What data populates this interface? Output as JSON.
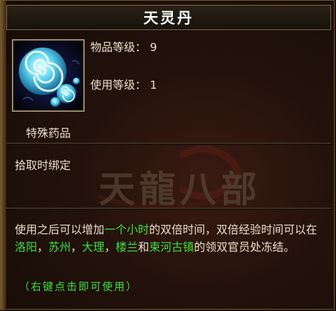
{
  "item": {
    "name": "天灵丹",
    "icon": "swirl-orb-icon",
    "item_level_label": "物品等级：",
    "item_level_value": "9",
    "use_level_label": "使用等级：",
    "use_level_value": "1",
    "category": "特殊药品",
    "binding": "拾取时绑定",
    "watermark_text": "天龍八部",
    "description": {
      "p1": "使用之后可以增加",
      "hl1": "一个小时",
      "p2": "的双倍时间，双倍经验时间可以在",
      "hl2": "洛阳",
      "sep1": "，",
      "hl3": "苏州",
      "sep2": "，",
      "hl4": "大理",
      "sep3": "，",
      "hl5": "楼兰",
      "p3": "和",
      "hl6": "束河古镇",
      "p4": "的领双官员处冻结。"
    },
    "usage_hint": "（右键点击即可使用）"
  },
  "colors": {
    "text": "#ecdfc8",
    "highlight": "#3ee03e",
    "title": "#ffffff",
    "frame": "#9c8a66"
  }
}
